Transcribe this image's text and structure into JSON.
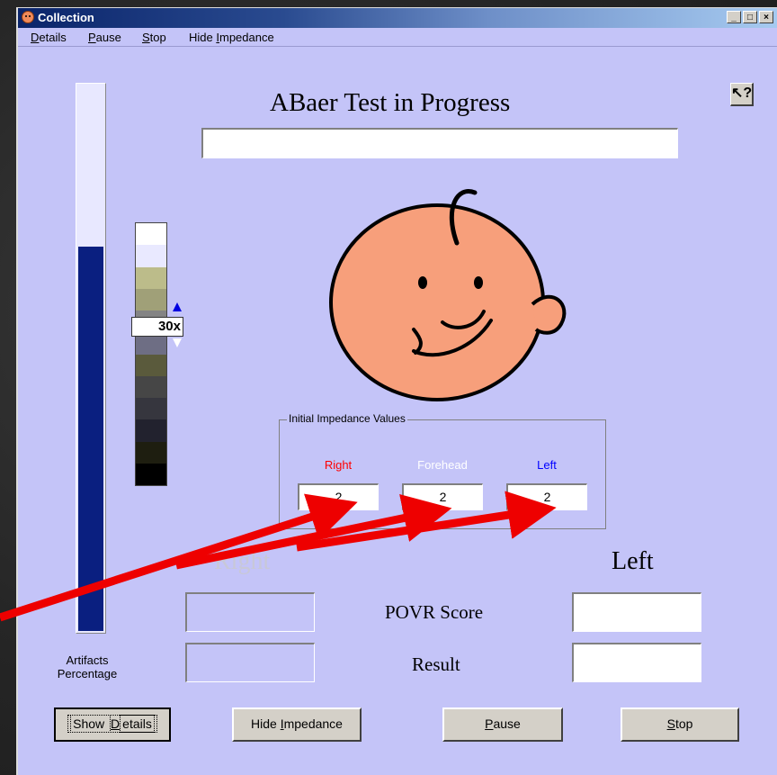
{
  "window": {
    "title": "Collection",
    "controls": {
      "minimize": "_",
      "maximize": "□",
      "close": "×"
    }
  },
  "menu": [
    {
      "pre": "",
      "u": "D",
      "post": "etails"
    },
    {
      "pre": "",
      "u": "P",
      "post": "ause"
    },
    {
      "pre": "",
      "u": "S",
      "post": "top"
    },
    {
      "pre": "Hide ",
      "u": "I",
      "post": "mpedance"
    }
  ],
  "main": {
    "title": "ABaer Test in Progress",
    "status_text": "",
    "help_icon": "help-cursor-icon"
  },
  "progress": {
    "artifacts_fraction": 0.7,
    "fill_color": "#0a1f80"
  },
  "scale": {
    "label": "30x",
    "colors": [
      "#ffffff",
      "#e9e9ff",
      "#bcbc8a",
      "#a0a078",
      "#848484",
      "#6e6e84",
      "#5a5a3c",
      "#464646",
      "#36363e",
      "#22222e",
      "#1e1e10",
      "#000000"
    ]
  },
  "impedance": {
    "group_title": "Initial Impedance Values",
    "channels": [
      {
        "label": "Right",
        "value": "2",
        "color": "#ff0000"
      },
      {
        "label": "Forehead",
        "value": "2",
        "color": "#ffffff"
      },
      {
        "label": "Left",
        "value": "2",
        "color": "#0000ff"
      }
    ]
  },
  "results": {
    "right_label": "Right",
    "left_label": "Left",
    "povr_label": "POVR Score",
    "result_label": "Result",
    "right_povr": "",
    "right_result": "",
    "left_povr": "",
    "left_result": ""
  },
  "artifacts": {
    "line1": "Artifacts",
    "line2": "Percentage"
  },
  "buttons": {
    "show_details": {
      "pre": "Show ",
      "u": "D",
      "post": "etails"
    },
    "hide_impedance": {
      "pre": "Hide ",
      "u": "I",
      "post": "mpedance"
    },
    "pause": {
      "pre": "",
      "u": "P",
      "post": "ause"
    },
    "stop": {
      "pre": "",
      "u": "S",
      "post": "top"
    }
  },
  "annotation": {
    "arrow_color": "#ee0000"
  }
}
